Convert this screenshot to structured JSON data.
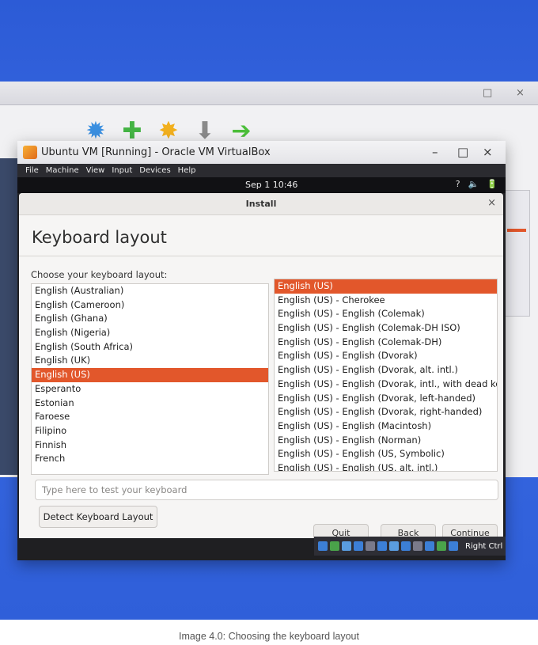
{
  "host": {
    "controls": [
      "□",
      "×"
    ]
  },
  "vbox_toolbar": {
    "icons": [
      "gear-icon",
      "plus-icon",
      "settings-icon",
      "discard-icon",
      "start-icon"
    ]
  },
  "vm_window": {
    "title": "Ubuntu VM [Running] - Oracle VM VirtualBox",
    "controls": {
      "minimize": "–",
      "maximize": "□",
      "close": "×"
    },
    "menu": [
      "File",
      "Machine",
      "View",
      "Input",
      "Devices",
      "Help"
    ]
  },
  "top_bar": {
    "clock": "Sep 1  10:46",
    "tray": [
      "?",
      "🔈",
      "🔋"
    ]
  },
  "dialog": {
    "title": "Install",
    "close": "×",
    "heading": "Keyboard layout",
    "choose_label": "Choose your keyboard layout:",
    "layouts": [
      "English (Australian)",
      "English (Cameroon)",
      "English (Ghana)",
      "English (Nigeria)",
      "English (South Africa)",
      "English (UK)",
      "English (US)",
      "Esperanto",
      "Estonian",
      "Faroese",
      "Filipino",
      "Finnish",
      "French"
    ],
    "selected_layout": "English (US)",
    "variants": [
      "English (US)",
      "English (US) - Cherokee",
      "English (US) - English (Colemak)",
      "English (US) - English (Colemak-DH ISO)",
      "English (US) - English (Colemak-DH)",
      "English (US) - English (Dvorak)",
      "English (US) - English (Dvorak, alt. intl.)",
      "English (US) - English (Dvorak, intl., with dead keys)",
      "English (US) - English (Dvorak, left-handed)",
      "English (US) - English (Dvorak, right-handed)",
      "English (US) - English (Macintosh)",
      "English (US) - English (Norman)",
      "English (US) - English (US, Symbolic)",
      "English (US) - English (US, alt. intl.)"
    ],
    "selected_variant": "English (US)",
    "test_placeholder": "Type here to test your keyboard",
    "detect_button": "Detect Keyboard Layout",
    "quit_button": "Quit",
    "back_button": "Back",
    "continue_button": "Continue"
  },
  "vb_status": {
    "host_key": "Right Ctrl",
    "colors": [
      "#3c7fd6",
      "#4aa34a",
      "#5a9de0",
      "#3c7fd6",
      "#7a7a8a",
      "#3c7fd6",
      "#5a9de0",
      "#3c7fd6",
      "#7a7a8a",
      "#3c7fd6",
      "#4aa34a",
      "#3c7fd6"
    ]
  },
  "caption": "Image 4.0: Choosing the keyboard layout"
}
